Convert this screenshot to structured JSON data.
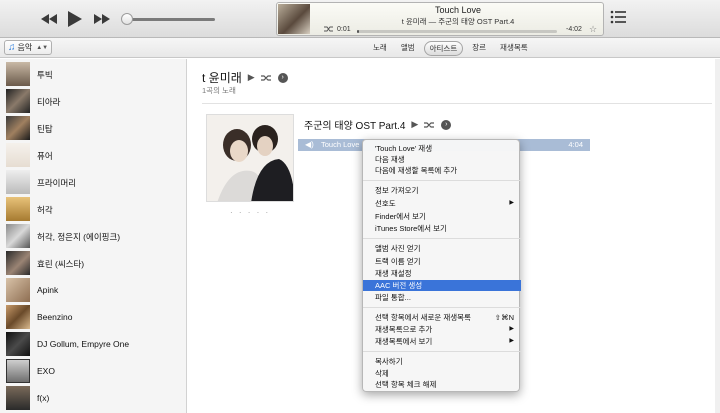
{
  "now_playing": {
    "title": "Touch Love",
    "subtitle": "t 윤미래 — 주군의 태양 OST Part.4",
    "elapsed": "0:01",
    "remaining": "-4:02",
    "progress": 0.005,
    "volume": 0.05
  },
  "nav": {
    "media_type": "음악",
    "tabs": [
      {
        "label": "노래",
        "active": false
      },
      {
        "label": "앨범",
        "active": false
      },
      {
        "label": "아티스트",
        "active": true
      },
      {
        "label": "장르",
        "active": false
      },
      {
        "label": "재생목록",
        "active": false
      }
    ]
  },
  "sidebar": {
    "artists": [
      {
        "name": "투빅"
      },
      {
        "name": "티아라"
      },
      {
        "name": "틴탑"
      },
      {
        "name": "퓨어"
      },
      {
        "name": "프라이머리"
      },
      {
        "name": "허각"
      },
      {
        "name": "허각, 정은지 (에이핑크)"
      },
      {
        "name": "효린 (씨스타)"
      },
      {
        "name": "Apink"
      },
      {
        "name": "Beenzino"
      },
      {
        "name": "DJ Gollum, Empyre One"
      },
      {
        "name": "EXO"
      },
      {
        "name": "f(x)"
      }
    ]
  },
  "main": {
    "artist_name": "t 윤미래",
    "song_count": "1곡의 노래",
    "album_title": "주군의 태양 OST Part.4",
    "track": {
      "name": "Touch Love",
      "duration": "4:04"
    }
  },
  "context_menu": {
    "items": [
      {
        "label": "'Touch Love' 재생",
        "type": "item"
      },
      {
        "label": "다음 재생",
        "type": "item"
      },
      {
        "label": "다음에 재생할 목록에 추가",
        "type": "item"
      },
      {
        "type": "sep"
      },
      {
        "label": "정보 가져오기",
        "type": "item"
      },
      {
        "label": "선호도",
        "type": "submenu"
      },
      {
        "label": "Finder에서 보기",
        "type": "item"
      },
      {
        "label": "iTunes Store에서 보기",
        "type": "item"
      },
      {
        "type": "sep"
      },
      {
        "label": "앨범 사진 얻기",
        "type": "item"
      },
      {
        "label": "트랙 이름 얻기",
        "type": "item"
      },
      {
        "label": "재생 재설정",
        "type": "item"
      },
      {
        "label": "AAC 버전 생성",
        "type": "item",
        "highlighted": true
      },
      {
        "label": "파일 통합...",
        "type": "item"
      },
      {
        "type": "sep"
      },
      {
        "label": "선택 항목에서 새로운 재생목록",
        "type": "item",
        "shortcut": "⇧⌘N"
      },
      {
        "label": "재생목록으로 추가",
        "type": "submenu"
      },
      {
        "label": "재생목록에서 보기",
        "type": "submenu"
      },
      {
        "type": "sep"
      },
      {
        "label": "복사하기",
        "type": "item"
      },
      {
        "label": "삭제",
        "type": "item"
      },
      {
        "label": "선택 항목 체크 해제",
        "type": "item"
      }
    ]
  },
  "colors": {
    "highlight": "#3a74d9",
    "track_row": "#a9bcd6"
  }
}
